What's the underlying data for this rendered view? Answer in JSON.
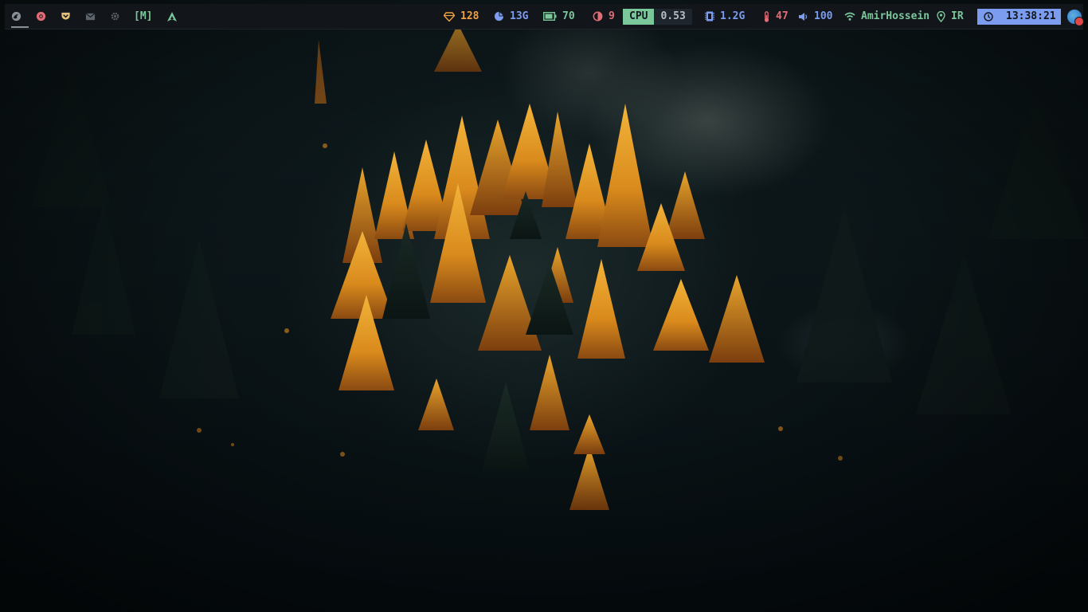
{
  "desktop": {
    "wallpaper": "autumn-forest-wallpaper"
  },
  "topbar": {
    "workspaces": [
      {
        "icon": "firefox-icon",
        "color": "#8a8f96",
        "active": true
      },
      {
        "icon": "chrome-icon",
        "color": "#e06c75",
        "active": false
      },
      {
        "icon": "pocket-icon",
        "color": "#e5c07b",
        "active": false
      },
      {
        "icon": "mail-icon",
        "color": "#5c636b",
        "active": false
      },
      {
        "icon": "gear-icon",
        "color": "#5c636b",
        "active": false
      }
    ],
    "layout_indicator": "[M]",
    "updates": {
      "value": "128",
      "icon": "gem-icon",
      "color": "#f0a040"
    },
    "disk": {
      "value": "13G",
      "icon": "pie-chart-icon",
      "color": "#7c9cf0"
    },
    "battery": {
      "value": "70",
      "icon": "battery-icon",
      "color": "#7ac79a"
    },
    "brightness": {
      "value": "9",
      "icon": "brightness-icon",
      "color": "#e06c75"
    },
    "cpu": {
      "label": "CPU",
      "value": "0.53",
      "color": "#7ac79a"
    },
    "memory": {
      "value": "1.2G",
      "icon": "memory-icon",
      "color": "#7c9cf0"
    },
    "temperature": {
      "value": "47",
      "icon": "thermometer-icon",
      "color": "#e06c75"
    },
    "volume": {
      "value": "100",
      "icon": "volume-icon",
      "color": "#7c9cf0"
    },
    "network": {
      "value": "AmirHossein",
      "icon": "wifi-icon",
      "color": "#7ac79a"
    },
    "location": {
      "value": "IR",
      "icon": "location-pin-icon",
      "color": "#7ac79a"
    },
    "clock": {
      "value": "13:38:21",
      "icon": "clock-icon",
      "color": "#7c9cf0"
    },
    "tray": {
      "icon": "avatar-icon"
    }
  }
}
